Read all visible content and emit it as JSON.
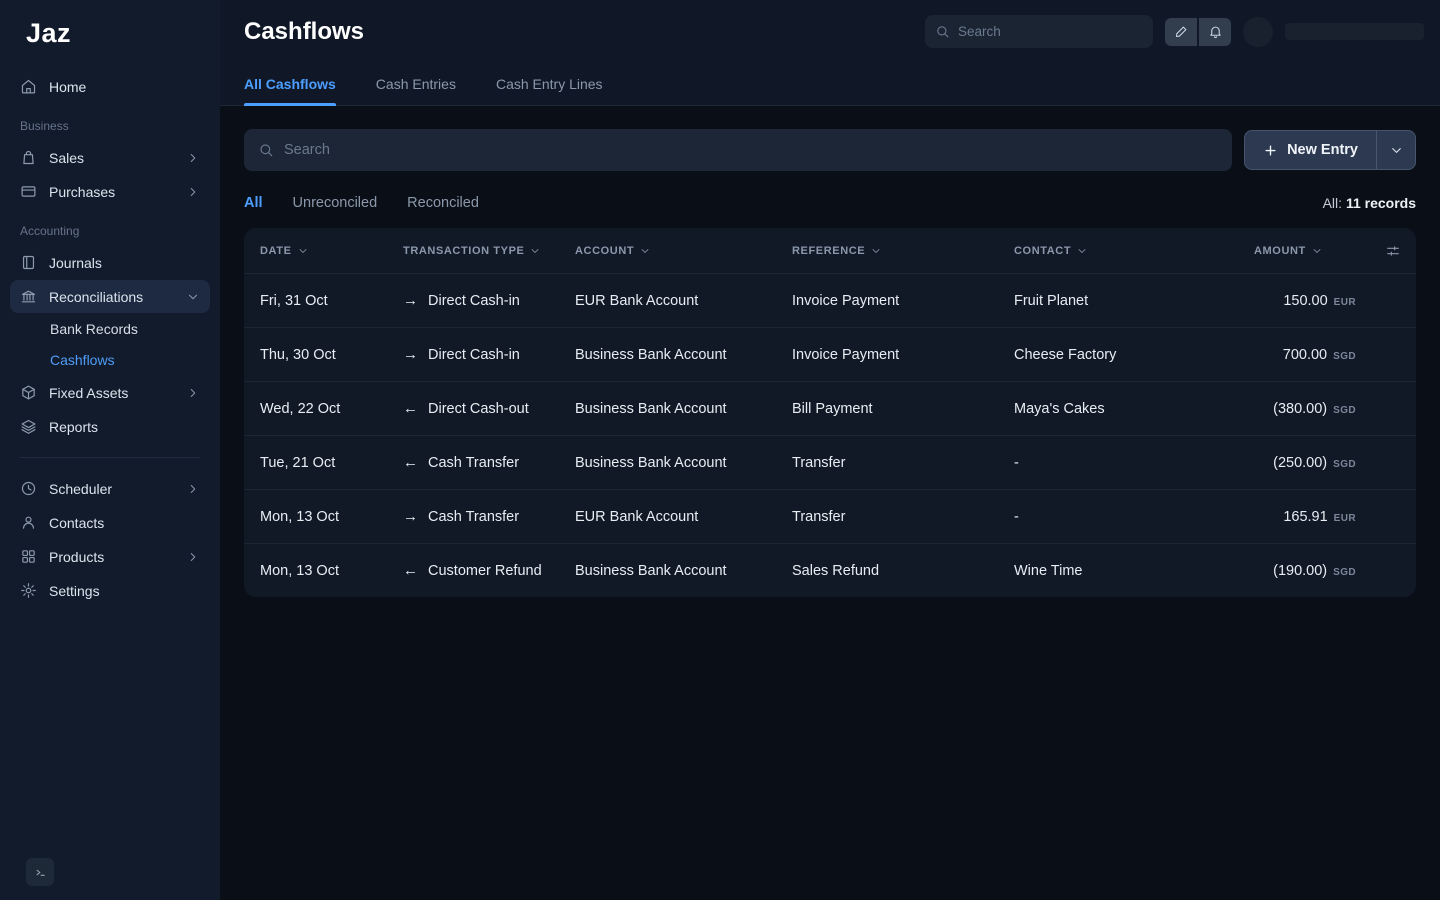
{
  "colors": {
    "accent": "#4c9eff",
    "sidebar_bg": "#111b2b",
    "content_bg": "#0a0f17",
    "card_bg": "#111927"
  },
  "brand": {
    "logo": "Jaz"
  },
  "sidebar": {
    "home": "Home",
    "business_section": "Business",
    "sales": "Sales",
    "purchases": "Purchases",
    "accounting_section": "Accounting",
    "journals": "Journals",
    "reconciliations": "Reconciliations",
    "bank_records": "Bank Records",
    "cashflows": "Cashflows",
    "fixed_assets": "Fixed Assets",
    "reports": "Reports",
    "scheduler": "Scheduler",
    "contacts": "Contacts",
    "products": "Products",
    "settings": "Settings"
  },
  "header": {
    "title": "Cashflows",
    "search_placeholder": "Search"
  },
  "tabs": {
    "all_cashflows": "All Cashflows",
    "cash_entries": "Cash Entries",
    "cash_entry_lines": "Cash Entry Lines"
  },
  "toolbar": {
    "search_placeholder": "Search",
    "new_entry_label": "New Entry"
  },
  "filters": {
    "all": "All",
    "unreconciled": "Unreconciled",
    "reconciled": "Reconciled",
    "count_prefix": "All:",
    "count_value": "11 records"
  },
  "table": {
    "columns": [
      "Date",
      "Transaction Type",
      "Account",
      "Reference",
      "Contact",
      "Amount"
    ],
    "rows": [
      {
        "date": "Fri, 31 Oct",
        "arrow": "→",
        "type": "Direct Cash-in",
        "account": "EUR Bank Account",
        "reference": "Invoice Payment",
        "contact": "Fruit Planet",
        "amount": "150.00",
        "currency": "EUR"
      },
      {
        "date": "Thu, 30 Oct",
        "arrow": "→",
        "type": "Direct Cash-in",
        "account": "Business Bank Account",
        "reference": "Invoice Payment",
        "contact": "Cheese Factory",
        "amount": "700.00",
        "currency": "SGD"
      },
      {
        "date": "Wed, 22 Oct",
        "arrow": "←",
        "type": "Direct Cash-out",
        "account": "Business Bank Account",
        "reference": "Bill Payment",
        "contact": "Maya's Cakes",
        "amount": "(380.00)",
        "currency": "SGD"
      },
      {
        "date": "Tue, 21 Oct",
        "arrow": "←",
        "type": "Cash Transfer",
        "account": "Business Bank Account",
        "reference": "Transfer",
        "contact": "-",
        "amount": "(250.00)",
        "currency": "SGD"
      },
      {
        "date": "Mon, 13 Oct",
        "arrow": "→",
        "type": "Cash Transfer",
        "account": "EUR Bank Account",
        "reference": "Transfer",
        "contact": "-",
        "amount": "165.91",
        "currency": "EUR"
      },
      {
        "date": "Mon, 13 Oct",
        "arrow": "←",
        "type": "Customer Refund",
        "account": "Business Bank Account",
        "reference": "Sales Refund",
        "contact": "Wine Time",
        "amount": "(190.00)",
        "currency": "SGD"
      }
    ]
  }
}
